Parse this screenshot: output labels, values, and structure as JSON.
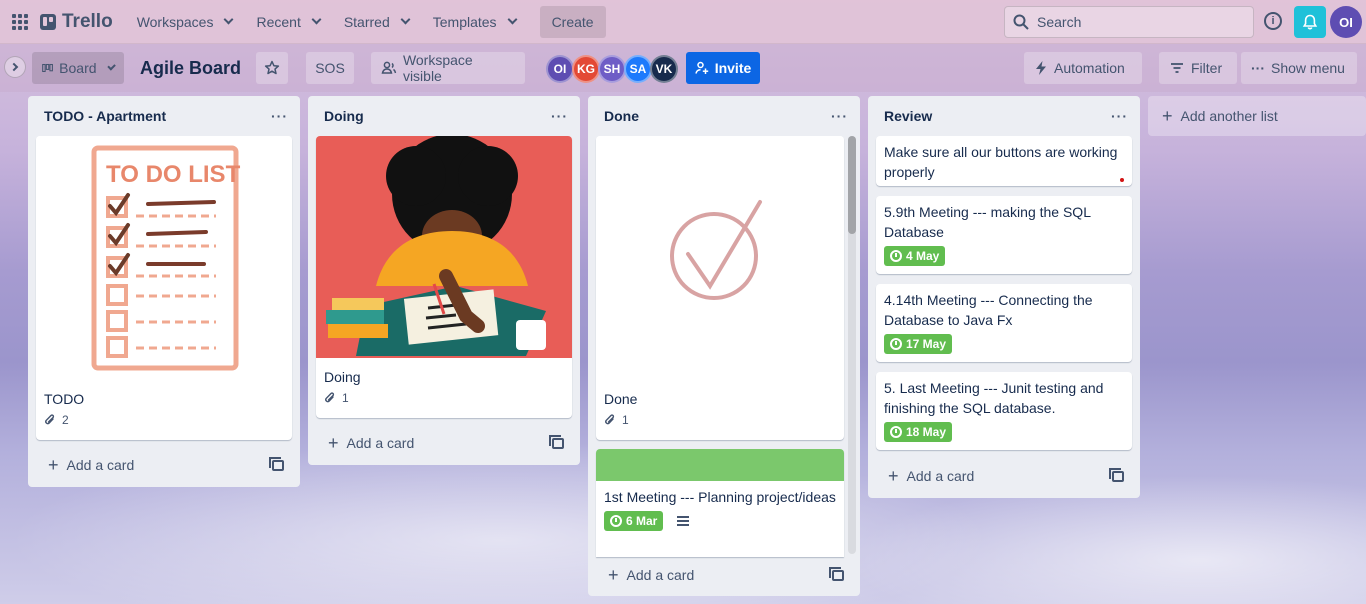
{
  "topnav": {
    "logo_text": "Trello",
    "menus": [
      "Workspaces",
      "Recent",
      "Starred",
      "Templates"
    ],
    "create_label": "Create",
    "search_placeholder": "Search",
    "info_symbol": "i",
    "user_initials": "OI"
  },
  "board": {
    "view_label": "Board",
    "title": "Agile Board",
    "sos_label": "SOS",
    "visibility_label": "Workspace visible",
    "members": [
      {
        "initials": "OI",
        "color": "#5e4db2"
      },
      {
        "initials": "KG",
        "color": "#e34935"
      },
      {
        "initials": "SH",
        "color": "#6e5dc6"
      },
      {
        "initials": "SA",
        "color": "#1d7afc"
      },
      {
        "initials": "VK",
        "color": "#172b4d"
      }
    ],
    "invite_label": "Invite",
    "automation_label": "Automation",
    "filter_label": "Filter",
    "show_menu_label": "Show menu"
  },
  "lists": [
    {
      "title": "TODO - Apartment",
      "cards": [
        {
          "title": "TODO",
          "attachments": "2"
        }
      ],
      "add_card_label": "Add a card"
    },
    {
      "title": "Doing",
      "cards": [
        {
          "title": "Doing",
          "attachments": "1"
        }
      ],
      "add_card_label": "Add a card"
    },
    {
      "title": "Done",
      "cards": [
        {
          "title": "Done",
          "attachments": "1"
        },
        {
          "title": "1st Meeting --- Planning project/ideas",
          "due": "6 Mar",
          "cover_color": "#7bc86c"
        }
      ],
      "add_card_label": "Add a card"
    },
    {
      "title": "Review",
      "cards": [
        {
          "title": "Make sure all our buttons are working properly"
        },
        {
          "title": "5.9th Meeting --- making the SQL Database",
          "due": "4 May"
        },
        {
          "title": "4.14th Meeting --- Connecting the Database to Java Fx",
          "due": "17 May"
        },
        {
          "title": "5. Last Meeting --- Junit testing and finishing the SQL database.",
          "due": "18 May"
        }
      ],
      "add_card_label": "Add a card"
    }
  ],
  "add_list_label": "Add another list",
  "list_menu_symbol": "···",
  "colors": {
    "due_complete": "#61bd4f",
    "invite": "#0c66e4",
    "notify": "#1fc1d9"
  }
}
